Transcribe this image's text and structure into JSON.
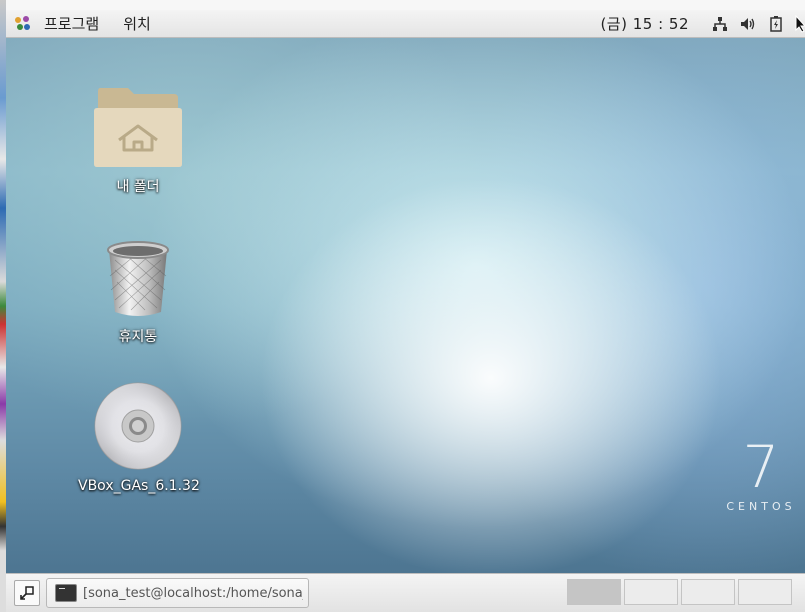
{
  "top_panel": {
    "applications_label": "프로그램",
    "places_label": "위치",
    "clock": "(금) 15 : 52",
    "tray": [
      "network-icon",
      "volume-icon",
      "battery-icon"
    ]
  },
  "desktop": {
    "icons": [
      {
        "name": "home-folder",
        "label": "내 폴더"
      },
      {
        "name": "trash",
        "label": "휴지통"
      },
      {
        "name": "cd-drive",
        "label": "VBox_GAs_6.1.32"
      }
    ],
    "branding": {
      "version": "7",
      "name": "CENTOS"
    }
  },
  "bottom_panel": {
    "task_label": "[sona_test@localhost:/home/sona_…",
    "workspaces": 4,
    "active_workspace": 1
  },
  "colors": {
    "panel": "#e8e8e8",
    "folder": "#e3d5b9",
    "desktop_blue": "#7aaabf"
  }
}
